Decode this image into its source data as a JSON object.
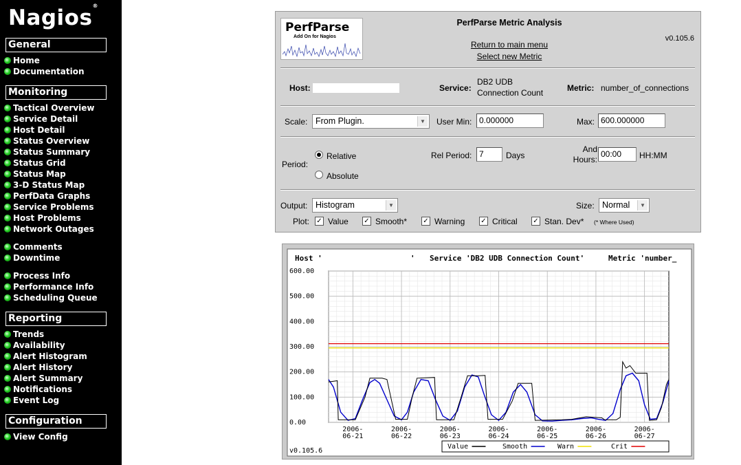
{
  "sidebar": {
    "logo": "Nagios",
    "logo_mark": "®",
    "sections": [
      {
        "title": "General",
        "items": [
          "Home",
          "Documentation"
        ]
      },
      {
        "title": "Monitoring",
        "items": [
          "Tactical Overview",
          "Service Detail",
          "Host Detail",
          "Status Overview",
          "Status Summary",
          "Status Grid",
          "Status Map",
          "3-D Status Map",
          "PerfData Graphs",
          "Service Problems",
          "Host Problems",
          "Network Outages",
          "Comments",
          "Downtime",
          "Process Info",
          "Performance Info",
          "Scheduling Queue"
        ]
      },
      {
        "title": "Reporting",
        "items": [
          "Trends",
          "Availability",
          "Alert Histogram",
          "Alert History",
          "Alert Summary",
          "Notifications",
          "Event Log"
        ]
      },
      {
        "title": "Configuration",
        "items": [
          "View Config"
        ]
      }
    ]
  },
  "panel": {
    "logo_title": "PerfParse",
    "logo_sub": "Add On for Nagios",
    "title": "PerfParse Metric Analysis",
    "version": "v0.105.6",
    "link_main": "Return to main menu",
    "link_metric": "Select new Metric",
    "host_label": "Host:",
    "host_value": "",
    "service_label": "Service:",
    "service_value": "DB2 UDB Connection Count",
    "metric_label": "Metric:",
    "metric_value": "number_of_connections",
    "scale_label": "Scale:",
    "scale_value": "From Plugin.",
    "usermin_label": "User Min:",
    "usermin_value": "0.000000",
    "max_label": "Max:",
    "max_value": "600.000000",
    "period_label": "Period:",
    "relative_label": "Relative",
    "absolute_label": "Absolute",
    "relperiod_label": "Rel Period:",
    "relperiod_value": "7",
    "days_label": "Days",
    "andhours_label": "And Hours:",
    "hours_value": "00:00",
    "hhmm_label": "HH:MM",
    "output_label": "Output:",
    "output_value": "Histogram",
    "size_label": "Size:",
    "size_value": "Normal",
    "plot_label": "Plot:",
    "plot_options": [
      "Value",
      "Smooth*",
      "Warning",
      "Critical",
      "Stan. Dev*"
    ],
    "where_used": "(* Where Used)"
  },
  "chart_data": {
    "type": "line",
    "title_host": "Host '",
    "title_quote": "'",
    "title_service": "Service 'DB2 UDB Connection Count'",
    "title_metric": "Metric 'number_",
    "x_tick_labels": [
      [
        "2006-",
        "06-21"
      ],
      [
        "2006-",
        "06-22"
      ],
      [
        "2006-",
        "06-23"
      ],
      [
        "2006-",
        "06-24"
      ],
      [
        "2006-",
        "06-25"
      ],
      [
        "2006-",
        "06-26"
      ],
      [
        "2006-",
        "06-27"
      ]
    ],
    "y_tick_labels": [
      "600.00",
      "500.00",
      "400.00",
      "300.00",
      "200.00",
      "100.00",
      "0.00"
    ],
    "ylim": [
      0,
      600
    ],
    "x_range_days": [
      0,
      7
    ],
    "warn": 295,
    "crit": 312,
    "version": "v0.105.6",
    "legend": [
      {
        "name": "Value",
        "color": "#000000"
      },
      {
        "name": "Smooth",
        "color": "#0000cc"
      },
      {
        "name": "Warn",
        "color": "#f0e000"
      },
      {
        "name": "Crit",
        "color": "#e00000"
      }
    ],
    "value_series": [
      [
        0.0,
        160
      ],
      [
        0.18,
        165
      ],
      [
        0.2,
        10
      ],
      [
        0.55,
        10
      ],
      [
        0.75,
        100
      ],
      [
        0.85,
        175
      ],
      [
        1.1,
        175
      ],
      [
        1.2,
        170
      ],
      [
        1.38,
        12
      ],
      [
        1.62,
        12
      ],
      [
        1.72,
        100
      ],
      [
        1.82,
        175
      ],
      [
        2.18,
        178
      ],
      [
        2.22,
        10
      ],
      [
        2.58,
        10
      ],
      [
        2.72,
        95
      ],
      [
        2.86,
        185
      ],
      [
        3.08,
        185
      ],
      [
        3.22,
        186
      ],
      [
        3.28,
        12
      ],
      [
        3.58,
        12
      ],
      [
        3.78,
        85
      ],
      [
        3.9,
        155
      ],
      [
        4.18,
        155
      ],
      [
        4.25,
        8
      ],
      [
        4.8,
        10
      ],
      [
        5.0,
        12
      ],
      [
        5.3,
        22
      ],
      [
        5.62,
        18
      ],
      [
        5.68,
        10
      ],
      [
        5.92,
        10
      ],
      [
        6.0,
        20
      ],
      [
        6.05,
        240
      ],
      [
        6.12,
        215
      ],
      [
        6.2,
        225
      ],
      [
        6.32,
        195
      ],
      [
        6.55,
        195
      ],
      [
        6.6,
        8
      ],
      [
        6.75,
        10
      ],
      [
        6.85,
        60
      ],
      [
        6.95,
        150
      ],
      [
        7.0,
        170
      ]
    ],
    "smooth_series": [
      [
        0.0,
        170
      ],
      [
        0.1,
        140
      ],
      [
        0.25,
        40
      ],
      [
        0.4,
        8
      ],
      [
        0.55,
        15
      ],
      [
        0.7,
        90
      ],
      [
        0.85,
        158
      ],
      [
        0.95,
        170
      ],
      [
        1.05,
        155
      ],
      [
        1.2,
        90
      ],
      [
        1.35,
        25
      ],
      [
        1.5,
        10
      ],
      [
        1.62,
        40
      ],
      [
        1.75,
        120
      ],
      [
        1.9,
        170
      ],
      [
        2.05,
        165
      ],
      [
        2.2,
        90
      ],
      [
        2.35,
        25
      ],
      [
        2.5,
        8
      ],
      [
        2.65,
        45
      ],
      [
        2.8,
        140
      ],
      [
        2.95,
        188
      ],
      [
        3.08,
        180
      ],
      [
        3.2,
        110
      ],
      [
        3.35,
        30
      ],
      [
        3.5,
        8
      ],
      [
        3.65,
        40
      ],
      [
        3.8,
        120
      ],
      [
        3.95,
        150
      ],
      [
        4.08,
        120
      ],
      [
        4.25,
        30
      ],
      [
        4.4,
        6
      ],
      [
        4.6,
        5
      ],
      [
        4.8,
        8
      ],
      [
        5.0,
        10
      ],
      [
        5.2,
        15
      ],
      [
        5.4,
        18
      ],
      [
        5.55,
        12
      ],
      [
        5.7,
        8
      ],
      [
        5.85,
        35
      ],
      [
        6.0,
        130
      ],
      [
        6.12,
        185
      ],
      [
        6.25,
        195
      ],
      [
        6.38,
        165
      ],
      [
        6.5,
        70
      ],
      [
        6.62,
        12
      ],
      [
        6.75,
        15
      ],
      [
        6.88,
        80
      ],
      [
        7.0,
        165
      ]
    ]
  }
}
